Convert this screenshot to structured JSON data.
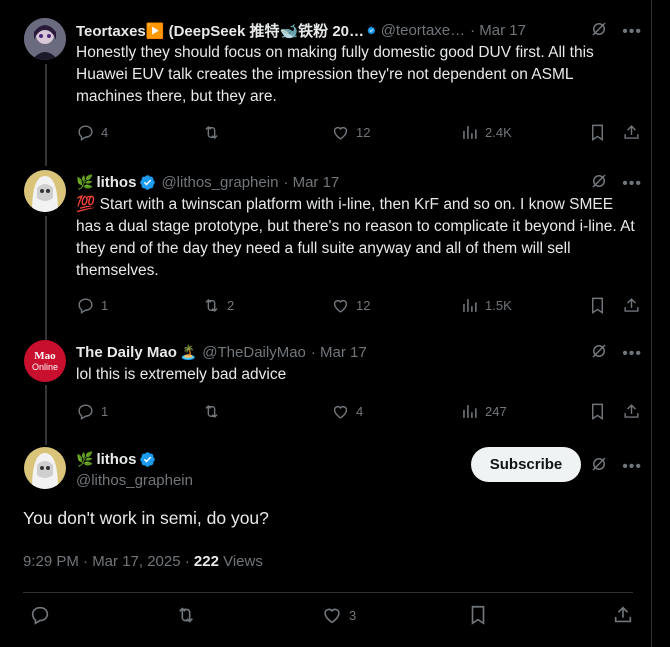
{
  "tweets": [
    {
      "name": "Teortaxes▶️ (DeepSeek 推特🐋铁粉 20…",
      "handle": "@teortaxe…",
      "date": "· Mar 17",
      "text": "Honestly they should focus on making fully domestic good DUV first. All this Huawei EUV talk creates the impression they're not dependent on ASML machines there, but they are.",
      "replies": "4",
      "reposts": "",
      "likes": "12",
      "views": "2.4K"
    },
    {
      "name": "lithos",
      "handle": "@lithos_graphein",
      "date": "· Mar 17",
      "text": "💯 Start with a twinscan platform with i-line, then KrF and so on. I know SMEE has a dual stage prototype, but there's no reason to complicate it beyond i-line. At they end of the day they need a full suite anyway and all of them will sell themselves.",
      "replies": "1",
      "reposts": "2",
      "likes": "12",
      "views": "1.5K"
    },
    {
      "name": "The Daily Mao",
      "handle": "@TheDailyMao",
      "date": "· Mar 17",
      "text": "lol this is extremely bad advice",
      "replies": "1",
      "reposts": "",
      "likes": "4",
      "views": "247"
    }
  ],
  "main": {
    "name": "lithos",
    "handle": "@lithos_graphein",
    "subscribe_label": "Subscribe",
    "text": "You don't work in semi, do you?",
    "timestamp": "9:29 PM · Mar 17, 2025 · ",
    "views_count": "222",
    "views_label": " Views",
    "likes": "3"
  },
  "avatar_text": {
    "mao_top": "Mao",
    "mao_bottom": "Online"
  },
  "colors": {
    "background": "#000000",
    "text": "#e7e9ea",
    "muted": "#71767b",
    "verified": "#1d9bf0",
    "mao_red": "#c8102e"
  }
}
